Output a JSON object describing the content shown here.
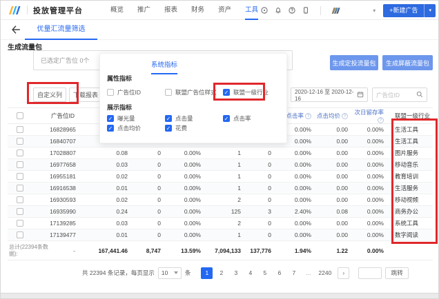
{
  "header": {
    "brand": "投放管理平台",
    "nav": [
      {
        "label": "概览",
        "active": false
      },
      {
        "label": "推广",
        "active": false
      },
      {
        "label": "报表",
        "active": false
      },
      {
        "label": "财务",
        "active": false
      },
      {
        "label": "资产",
        "active": false
      },
      {
        "label": "工具",
        "active": true
      }
    ],
    "new_ad_button": "+新建广告"
  },
  "tabbar": {
    "active_tab": "优量汇流量筛选"
  },
  "toolbar": {
    "section_title": "生成流量包",
    "selected_info": "已选定广告位 0个",
    "generate_target_button": "生成定投流量包",
    "generate_block_button": "生成屏蔽流量包"
  },
  "filters": {
    "customize_columns_button": "自定义列",
    "download_report_button": "下载报表",
    "date_range": "2020-12-16 至 2020-12-16",
    "search_placeholder": "广告位ID"
  },
  "popup": {
    "tab": "系统指标",
    "attribute_section": "属性指标",
    "attribute_options": [
      {
        "label": "广告位ID",
        "checked": false
      },
      {
        "label": "联盟广告位样式",
        "checked": false
      },
      {
        "label": "联盟一级行业",
        "checked": true
      }
    ],
    "display_section": "展示指标",
    "display_options": [
      {
        "label": "曝光量",
        "checked": true
      },
      {
        "label": "点击量",
        "checked": true
      },
      {
        "label": "点击率",
        "checked": true
      },
      {
        "label": "点击均价",
        "checked": true
      },
      {
        "label": "花费",
        "checked": true
      }
    ]
  },
  "table": {
    "headers": [
      {
        "label": "广告位ID",
        "info": false
      },
      {
        "label": "",
        "info": false
      },
      {
        "label": "",
        "info": false
      },
      {
        "label": "",
        "info": false
      },
      {
        "label": "",
        "info": false
      },
      {
        "label": "",
        "info": false
      },
      {
        "label": "点击率",
        "info": true
      },
      {
        "label": "点击均价",
        "info": true
      },
      {
        "label": "次日留存率",
        "info": true
      },
      {
        "label": "联盟一级行业",
        "info": false
      }
    ],
    "rows": [
      {
        "id": "16828965",
        "cells": [
          "",
          "",
          "",
          "",
          "",
          "0.00%",
          "0.00",
          "0.00%"
        ],
        "industry": "生活工具"
      },
      {
        "id": "16840707",
        "cells": [
          "",
          "",
          "",
          "",
          "",
          "0.00%",
          "0.00",
          "0.00%"
        ],
        "industry": "生活工具"
      },
      {
        "id": "17028807",
        "cells": [
          "0.08",
          "0",
          "0.00%",
          "1",
          "0",
          "0.00%",
          "0.00",
          "0.00%"
        ],
        "industry": "图片服务"
      },
      {
        "id": "16977658",
        "cells": [
          "0.03",
          "0",
          "0.00%",
          "1",
          "0",
          "0.00%",
          "0.00",
          "0.00%"
        ],
        "industry": "移动音乐"
      },
      {
        "id": "16955181",
        "cells": [
          "0.02",
          "0",
          "0.00%",
          "1",
          "0",
          "0.00%",
          "0.00",
          "0.00%"
        ],
        "industry": "教育培训"
      },
      {
        "id": "16916538",
        "cells": [
          "0.01",
          "0",
          "0.00%",
          "1",
          "0",
          "0.00%",
          "0.00",
          "0.00%"
        ],
        "industry": "生活服务"
      },
      {
        "id": "16930593",
        "cells": [
          "0.02",
          "0",
          "0.00%",
          "2",
          "0",
          "0.00%",
          "0.00",
          "0.00%"
        ],
        "industry": "移动视频"
      },
      {
        "id": "16935990",
        "cells": [
          "0.24",
          "0",
          "0.00%",
          "125",
          "3",
          "2.40%",
          "0.08",
          "0.00%"
        ],
        "industry": "商务办公"
      },
      {
        "id": "17139285",
        "cells": [
          "0.03",
          "0",
          "0.00%",
          "2",
          "0",
          "0.00%",
          "0.00",
          "0.00%"
        ],
        "industry": "系统工具"
      },
      {
        "id": "17139477",
        "cells": [
          "0.01",
          "0",
          "0.00%",
          "1",
          "0",
          "0.00%",
          "0.00",
          "0.00%"
        ],
        "industry": "数字阅读"
      }
    ],
    "total": {
      "label": "总计(22394条数据):",
      "dash": "-",
      "cells": [
        "167,441.46",
        "8,747",
        "13.59%",
        "7,094,133",
        "137,776",
        "1.94%",
        "1.22",
        "0.00%"
      ],
      "industry": ""
    }
  },
  "pagination": {
    "summary_prefix": "共 22394 条记录，每页显示",
    "page_size": "10",
    "summary_suffix": "条",
    "pages": [
      "1",
      "2",
      "3",
      "4",
      "5",
      "6",
      "7",
      "...",
      "2240"
    ],
    "active_page": "1",
    "next_icon": "›",
    "jump_button": "跳转"
  },
  "icons": {
    "check": "✓",
    "info": "?",
    "caret_down": "▾"
  },
  "colors": {
    "primary": "#2468f2",
    "light_button": "#6d97ed",
    "annotation": "#e0272b"
  }
}
